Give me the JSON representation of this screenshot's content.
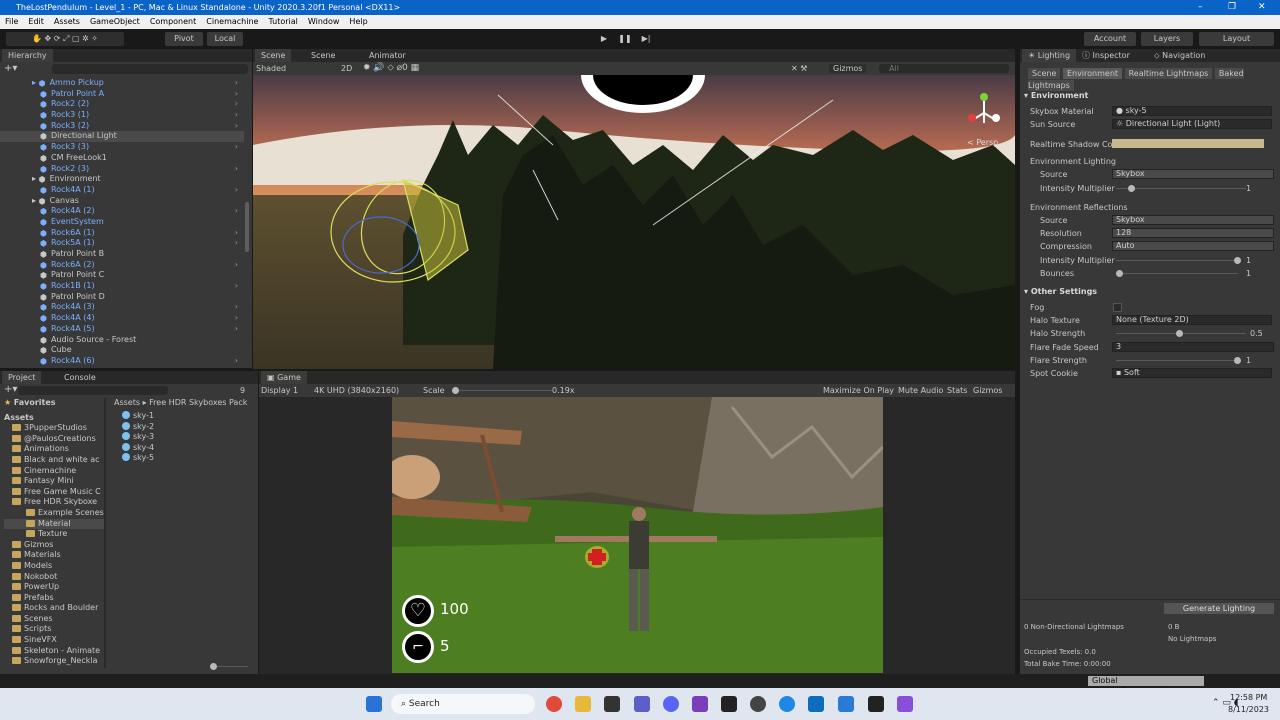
{
  "title": "TheLostPendulum - Level_1 - PC, Mac & Linux Standalone - Unity 2020.3.20f1 Personal <DX11>",
  "menu": [
    "File",
    "Edit",
    "Assets",
    "GameObject",
    "Component",
    "Cinemachine",
    "Tutorial",
    "Window",
    "Help"
  ],
  "toolbar": {
    "pivot": "Pivot",
    "local": "Local",
    "account": "Account",
    "layers": "Layers",
    "layout": "Layout"
  },
  "hierarchy": {
    "tab": "Hierarchy",
    "items": [
      {
        "label": "Ammo Pickup",
        "prefab": true,
        "arrow": true,
        "fold": true
      },
      {
        "label": "Patrol Point A",
        "prefab": true,
        "arrow": true
      },
      {
        "label": "Rock2 (2)",
        "prefab": true,
        "arrow": true
      },
      {
        "label": "Rock3 (1)",
        "prefab": true,
        "arrow": true
      },
      {
        "label": "Rock3 (2)",
        "prefab": true,
        "arrow": true
      },
      {
        "label": "Directional Light",
        "prefab": false,
        "sel": true
      },
      {
        "label": "Rock3 (3)",
        "prefab": true,
        "arrow": true
      },
      {
        "label": "CM FreeLook1",
        "prefab": false
      },
      {
        "label": "Rock2 (3)",
        "prefab": true,
        "arrow": true
      },
      {
        "label": "Environment",
        "prefab": false,
        "fold": true
      },
      {
        "label": "Rock4A (1)",
        "prefab": true,
        "arrow": true
      },
      {
        "label": "Canvas",
        "prefab": false,
        "fold": true
      },
      {
        "label": "Rock4A (2)",
        "prefab": true,
        "arrow": true
      },
      {
        "label": "EventSystem",
        "prefab": true
      },
      {
        "label": "Rock6A (1)",
        "prefab": true,
        "arrow": true
      },
      {
        "label": "Rock5A (1)",
        "prefab": true,
        "arrow": true
      },
      {
        "label": "Patrol Point B",
        "prefab": false
      },
      {
        "label": "Rock6A (2)",
        "prefab": true,
        "arrow": true
      },
      {
        "label": "Patrol Point C",
        "prefab": false
      },
      {
        "label": "Rock1B (1)",
        "prefab": true,
        "arrow": true
      },
      {
        "label": "Patrol Point D",
        "prefab": false
      },
      {
        "label": "Rock4A (3)",
        "prefab": true,
        "arrow": true
      },
      {
        "label": "Rock4A (4)",
        "prefab": true,
        "arrow": true
      },
      {
        "label": "Rock4A (5)",
        "prefab": true,
        "arrow": true
      },
      {
        "label": "Audio Source - Forest",
        "prefab": false
      },
      {
        "label": "Cube",
        "prefab": false
      },
      {
        "label": "Rock4A (6)",
        "prefab": true,
        "arrow": true
      }
    ]
  },
  "scene": {
    "tabs": [
      "Scene",
      "Scene",
      "Animator"
    ],
    "shading": "Shaded",
    "mode2d": "2D",
    "gizmos": "Gizmos",
    "search_placeholder": "All",
    "persp": "< Persp"
  },
  "project": {
    "tabs": [
      "Project",
      "Console"
    ],
    "favorites": "Favorites",
    "assets": "Assets",
    "folders": [
      "3PupperStudios",
      "@PaulosCreations",
      "Animations",
      "Black and white ac",
      "Cinemachine",
      "Fantasy Mini",
      "Free Game Music C",
      "Free HDR Skyboxe"
    ],
    "sub": [
      "Example Scenes",
      "Material",
      "Texture"
    ],
    "folders2": [
      "Gizmos",
      "Materials",
      "Models",
      "Nokobot",
      "PowerUp",
      "Prefabs",
      "Rocks and Boulder",
      "Scenes",
      "Scripts",
      "SineVFX",
      "Skeleton - Animate",
      "Snowforge_Neckla"
    ],
    "breadcrumb": [
      "Assets",
      "Free HDR Skyboxes Pack"
    ],
    "files": [
      "sky-1",
      "sky-2",
      "sky-3",
      "sky-4",
      "sky-5"
    ],
    "count": "9"
  },
  "game": {
    "tab": "Game",
    "display": "Display 1",
    "resolution": "4K UHD (3840x2160)",
    "scale_label": "Scale",
    "scale": "0.19x",
    "buttons": [
      "Maximize On Play",
      "Mute Audio",
      "Stats",
      "Gizmos"
    ],
    "health": "100",
    "ammo": "5"
  },
  "lighting": {
    "tabs": [
      "Lighting",
      "Inspector",
      "Navigation"
    ],
    "subtabs": [
      "Scene",
      "Environment",
      "Realtime Lightmaps",
      "Baked Lightmaps"
    ],
    "env_header": "Environment",
    "skybox_label": "Skybox Material",
    "skybox": "sky-5",
    "sun_label": "Sun Source",
    "sun": "Directional Light (Light)",
    "shadow_label": "Realtime Shadow Col",
    "envlight": "Environment Lighting",
    "source_label": "Source",
    "source": "Skybox",
    "intensity_label": "Intensity Multiplier",
    "intensity": "1",
    "envrefl": "Environment Reflections",
    "rsource": "Skybox",
    "res_label": "Resolution",
    "res": "128",
    "comp_label": "Compression",
    "comp": "Auto",
    "rint": "1",
    "bounces_label": "Bounces",
    "bounces": "1",
    "other": "Other Settings",
    "fog": "Fog",
    "halo_label": "Halo Texture",
    "halo": "None (Texture 2D)",
    "halostr_label": "Halo Strength",
    "halostr": "0.5",
    "fade_label": "Flare Fade Speed",
    "fade": "3",
    "flarestr_label": "Flare Strength",
    "flarestr": "1",
    "cookie_label": "Spot Cookie",
    "cookie": "Soft",
    "generate": "Generate Lighting",
    "lm1": "0 Non-Directional Lightmaps",
    "lm1v": "0 B",
    "nolm": "No Lightmaps",
    "occ": "Occupied Texels: 0.0",
    "bake": "Total Bake Time: 0:00:00"
  },
  "status": "Global Illumi...Preprocessing",
  "taskbar": {
    "search": "Search",
    "time": "12:58 PM",
    "date": "8/11/2023"
  }
}
